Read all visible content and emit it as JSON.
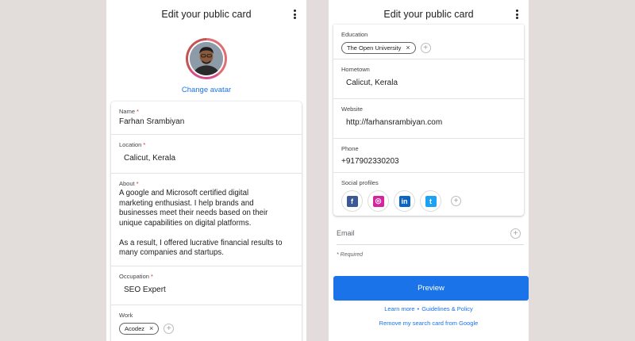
{
  "left": {
    "title": "Edit your public card",
    "change_avatar": "Change avatar",
    "fields": {
      "name": {
        "label": "Name",
        "required_mark": "*",
        "value": "Farhan Srambiyan"
      },
      "location": {
        "label": "Location",
        "required_mark": "*",
        "value": "Calicut, Kerala"
      },
      "about": {
        "label": "About",
        "required_mark": "*",
        "value": "A google and Microsoft certified digital\nmarketing enthusiast. I help brands and\nbusinesses meet their needs based on their\nunique capabilities on digital platforms.\n\nAs a result, I offered lucrative financial results to\nmany companies and startups."
      },
      "occupation": {
        "label": "Occupation",
        "required_mark": "*",
        "value": "SEO Expert"
      },
      "work": {
        "label": "Work",
        "chip": "Acodez",
        "chip_remove": "×",
        "add": "+"
      }
    }
  },
  "right": {
    "title": "Edit your public card",
    "fields": {
      "education": {
        "label": "Education",
        "chip": "The Open University",
        "chip_remove": "×",
        "add": "+"
      },
      "hometown": {
        "label": "Hometown",
        "value": "Calicut, Kerala"
      },
      "website": {
        "label": "Website",
        "value": "http://farhansrambiyan.com"
      },
      "phone": {
        "label": "Phone",
        "value": "+917902330203"
      },
      "social": {
        "label": "Social profiles",
        "profiles": [
          {
            "name": "facebook",
            "glyph": "f",
            "color": "#3b5998"
          },
          {
            "name": "instagram",
            "glyph": "◎",
            "color": "#d6249f"
          },
          {
            "name": "linkedin",
            "glyph": "in",
            "color": "#0a66c2"
          },
          {
            "name": "twitter",
            "glyph": "t",
            "color": "#1da1f2"
          }
        ],
        "add": "+"
      }
    },
    "email": {
      "label": "Email",
      "add": "+"
    },
    "required_note": "* Required",
    "preview_button": "Preview",
    "learn_more": "Learn more",
    "separator": "•",
    "guidelines": "Guidelines & Policy",
    "remove_card": "Remove my search card from Google"
  }
}
